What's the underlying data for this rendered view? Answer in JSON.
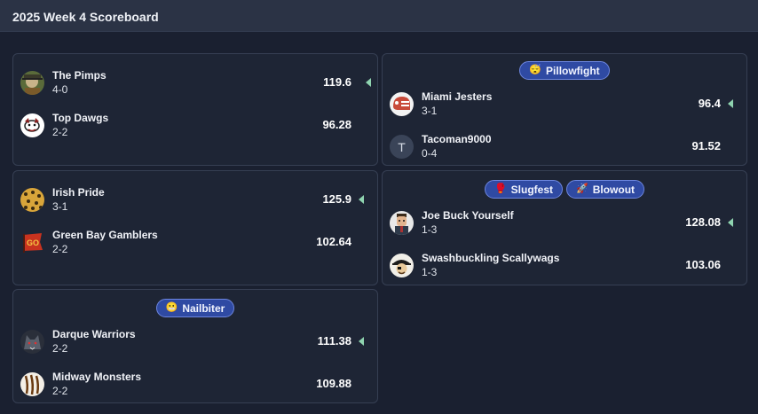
{
  "header": {
    "title": "2025 Week 4 Scoreboard"
  },
  "colors": {
    "win_arrow": "#8fd4b0",
    "badge_bg": "#2f4aa3",
    "badge_border": "#6d86de"
  },
  "matchups": [
    {
      "badges": [],
      "teams": [
        {
          "name": "The Pimps",
          "record": "4-0",
          "score": "119.6",
          "winner": true,
          "avatar_icon": "pimp-avatar-icon"
        },
        {
          "name": "Top Dawgs",
          "record": "2-2",
          "score": "96.28",
          "winner": false,
          "avatar_icon": "dog-avatar-icon"
        }
      ]
    },
    {
      "badges": [
        {
          "emoji": "😴",
          "label": "Pillowfight"
        }
      ],
      "teams": [
        {
          "name": "Miami Jesters",
          "record": "3-1",
          "score": "96.4",
          "winner": true,
          "avatar_icon": "football-helmet-avatar-icon"
        },
        {
          "name": "Tacoman9000",
          "record": "0-4",
          "score": "91.52",
          "winner": false,
          "avatar_icon": "letter-t-avatar-icon",
          "avatar_letter": "T"
        }
      ]
    },
    {
      "badges": [],
      "teams": [
        {
          "name": "Irish Pride",
          "record": "3-1",
          "score": "125.9",
          "winner": true,
          "avatar_icon": "leopard-avatar-icon"
        },
        {
          "name": "Green Bay Gamblers",
          "record": "2-2",
          "score": "102.64",
          "winner": false,
          "avatar_icon": "go-flag-avatar-icon",
          "avatar_text": "GO"
        }
      ]
    },
    {
      "badges": [
        {
          "emoji": "🥊",
          "label": "Slugfest"
        },
        {
          "emoji": "🚀",
          "label": "Blowout"
        }
      ],
      "teams": [
        {
          "name": "Joe Buck Yourself",
          "record": "1-3",
          "score": "128.08",
          "winner": true,
          "avatar_icon": "man-avatar-icon"
        },
        {
          "name": "Swashbuckling Scallywags",
          "record": "1-3",
          "score": "103.06",
          "winner": false,
          "avatar_icon": "pirate-avatar-icon"
        }
      ]
    },
    {
      "badges": [
        {
          "emoji": "😬",
          "label": "Nailbiter"
        }
      ],
      "teams": [
        {
          "name": "Darque Warriors",
          "record": "2-2",
          "score": "111.38",
          "winner": true,
          "avatar_icon": "wolf-avatar-icon"
        },
        {
          "name": "Midway Monsters",
          "record": "2-2",
          "score": "109.88",
          "winner": false,
          "avatar_icon": "tiger-claw-avatar-icon"
        }
      ]
    }
  ]
}
